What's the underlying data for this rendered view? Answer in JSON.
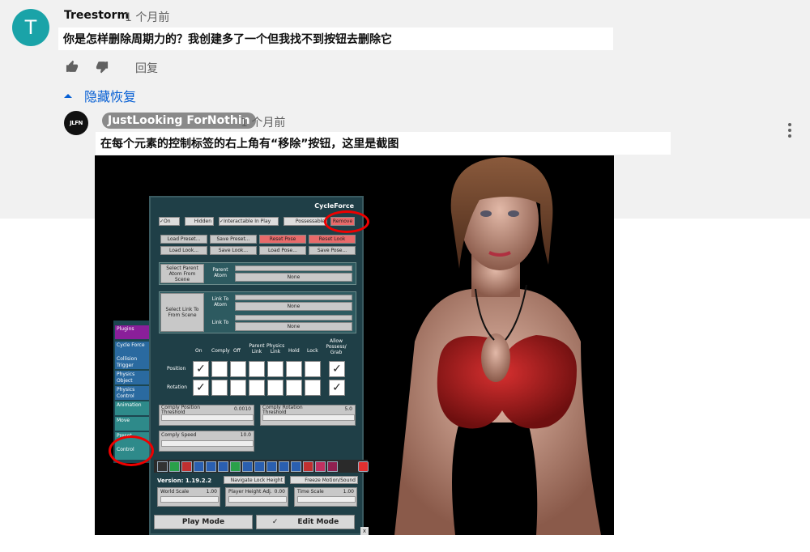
{
  "comment": {
    "avatar_letter": "T",
    "author": "Treestorm",
    "time": "1 个月前",
    "text": "你是怎样删除周期力的？我创建多了一个但我找不到按钮去删除它",
    "reply_label": "回复",
    "hide_replies_label": "隐藏恢复"
  },
  "reply": {
    "avatar_text": "JLFN",
    "author": "JustLooking ForNothin",
    "time": "1 个月前",
    "text": "在每个元素的控制标签的右上角有“移除”按钮，这里是截图"
  },
  "screenshot": {
    "panel_title": "CycleForce",
    "checkboxes": [
      {
        "label": "On",
        "checked": true
      },
      {
        "label": "Hidden",
        "checked": false
      },
      {
        "label": "Interactable In Play",
        "checked": true
      },
      {
        "label": "Possessable",
        "checked": false
      }
    ],
    "remove_label": "Remove",
    "preset_buttons": [
      "Load Preset...",
      "Save Preset...",
      "Reset Pose",
      "Reset Look"
    ],
    "look_buttons": [
      "Load Look...",
      "Save Look...",
      "Load Pose...",
      "Save Pose..."
    ],
    "select_parent_label": "Select Parent Atom From Scene",
    "parent_atom_label": "Parent Atom",
    "none_label": "None",
    "select_link_label": "Select Link To From Scene",
    "link_to_atom_label": "Link To Atom",
    "link_to_label": "Link To",
    "grid_headers": [
      "On",
      "Comply",
      "Off",
      "Parent Link",
      "Physics Link",
      "Hold",
      "Lock",
      "Allow Possess/ Grab"
    ],
    "grid_rows": [
      "Position",
      "Rotation"
    ],
    "comply_position_label": "Comply Position Threshold",
    "comply_position_value": "0.0010",
    "comply_rotation_label": "Comply Rotation Threshold",
    "comply_rotation_value": "5.0",
    "comply_speed_label": "Comply Speed",
    "comply_speed_value": "10.0",
    "side_tabs": [
      "Plugins",
      "Cycle Force",
      "Collision Trigger",
      "Physics Object",
      "Physics Control",
      "Animation",
      "Move",
      "Preset",
      "Control"
    ],
    "version": "Version: 1.19.2.2",
    "navigate_lock_label": "Navigate Lock Height",
    "freeze_label": "Freeze Motion/Sound",
    "world_scale_label": "World Scale",
    "world_scale_value": "1.00",
    "player_height_label": "Player Height Adj.",
    "player_height_value": "0.00",
    "time_scale_label": "Time Scale",
    "time_scale_value": "1.00",
    "play_mode_label": "Play Mode",
    "edit_mode_label": "Edit Mode",
    "close_label": "x",
    "colors": {
      "panel": "#1f3f47",
      "remove_button": "#e86a6a",
      "annotation": "#e00000",
      "dress": "#b01e1e"
    }
  }
}
